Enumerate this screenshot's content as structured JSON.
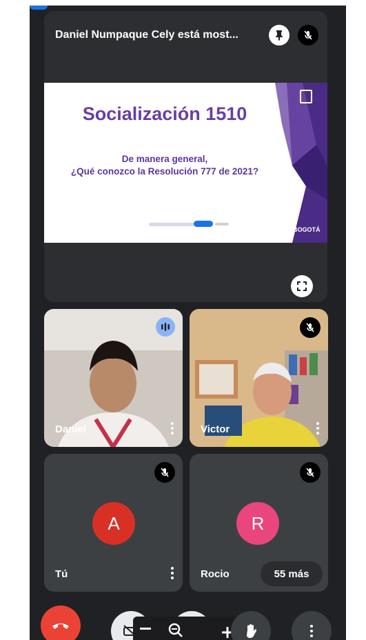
{
  "presentation": {
    "title": "Daniel Numpaque Cely está most...",
    "slide": {
      "heading": "Socialización 1510",
      "subtitle_line1": "De manera general,",
      "subtitle_line2": "¿Qué conozco la Resolución 777 de 2021?",
      "brand_text": "BOGOTÁ"
    }
  },
  "participants": [
    {
      "name": "Daniel",
      "speaking": true
    },
    {
      "name": "Victor",
      "muted": true
    },
    {
      "name": "Tú",
      "initial": "A",
      "avatar_color": "#d93025",
      "muted": true
    },
    {
      "name": "Rocio",
      "initial": "R",
      "avatar_color": "#e8467c",
      "muted": true
    }
  ],
  "more_participants": "55 más",
  "controls": {
    "end_call_color": "#ea4335"
  }
}
